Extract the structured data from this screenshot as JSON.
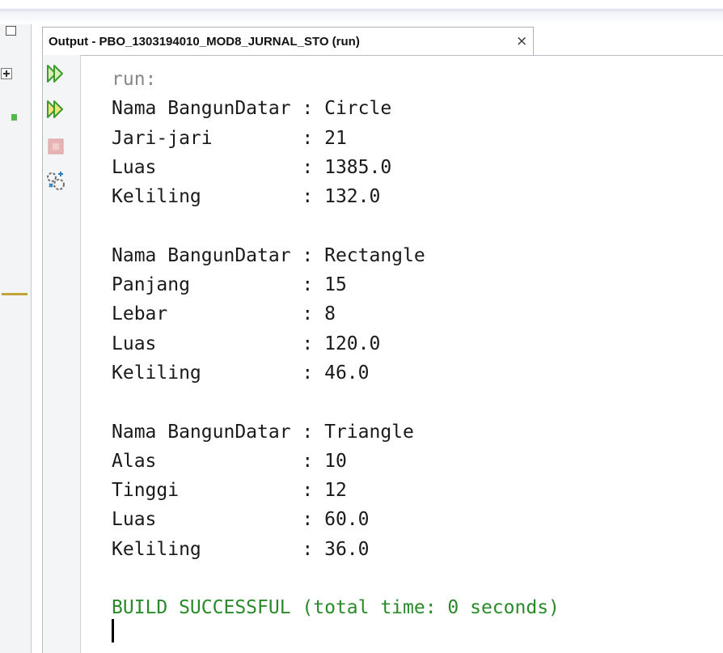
{
  "tab": {
    "title": "Output - PBO_1303194010_MOD8_JURNAL_STO (run)",
    "close_glyph": "×"
  },
  "toolbar": {
    "rerun_icon": "rerun-icon",
    "rerun_with_params_icon": "rerun-with-params-icon",
    "stop_icon": "stop-icon",
    "settings_icon": "output-settings-icon"
  },
  "output": {
    "run_text": "run:",
    "circle": {
      "name_line": "Nama BangunDatar : Circle",
      "radius_line": "Jari-jari        : 21",
      "area_line": "Luas             : 1385.0",
      "perimeter_line": "Keliling         : 132.0"
    },
    "rectangle": {
      "name_line": "Nama BangunDatar : Rectangle",
      "length_line": "Panjang          : 15",
      "width_line": "Lebar            : 8",
      "area_line": "Luas             : 120.0",
      "perimeter_line": "Keliling         : 46.0"
    },
    "triangle": {
      "name_line": "Nama BangunDatar : Triangle",
      "base_line": "Alas             : 10",
      "height_line": "Tinggi           : 12",
      "area_line": "Luas             : 60.0",
      "perimeter_line": "Keliling         : 36.0"
    },
    "build_text": "BUILD SUCCESSFUL (total time: 0 seconds)"
  },
  "colors": {
    "build_success": "#2a8a2a",
    "run_label": "#888888"
  }
}
